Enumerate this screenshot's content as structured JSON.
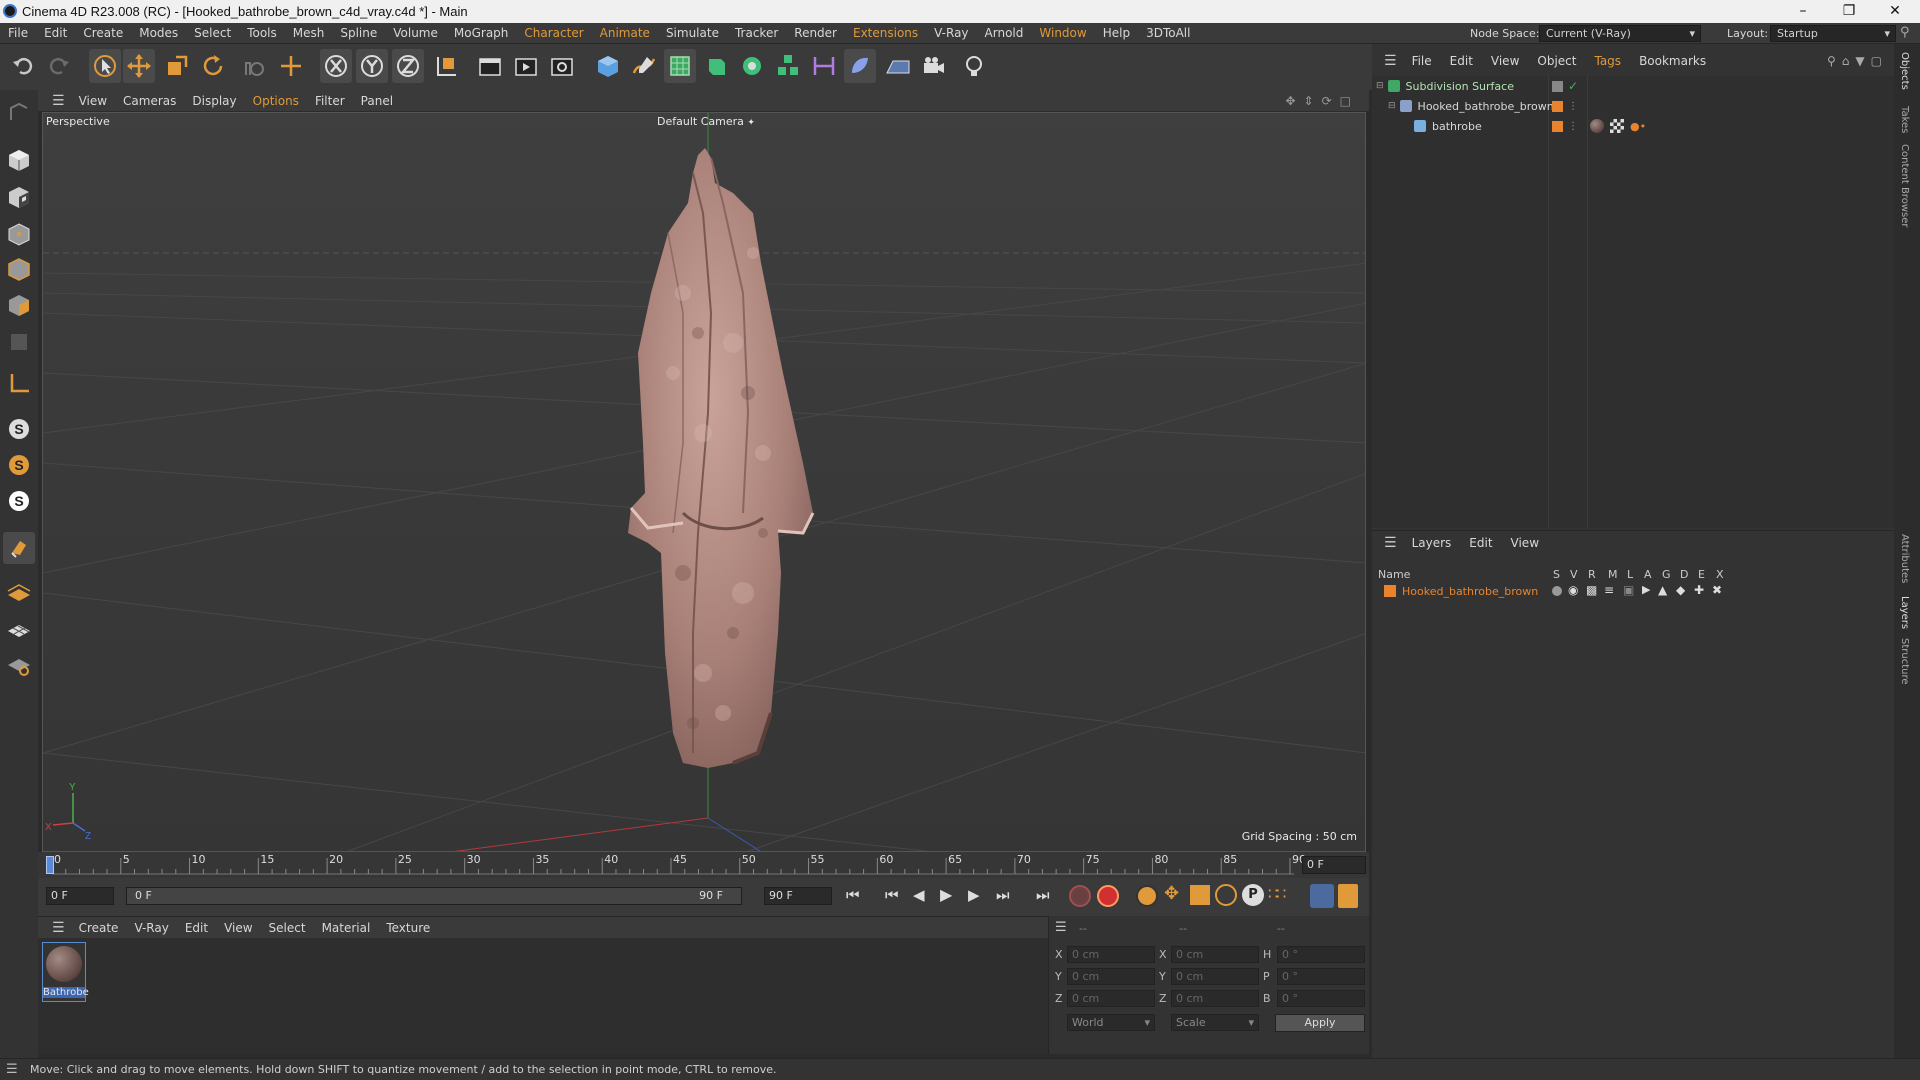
{
  "window": {
    "title": "Cinema 4D R23.008 (RC) - [Hooked_bathrobe_brown_c4d_vray.c4d *] - Main"
  },
  "menu": [
    "File",
    "Edit",
    "Create",
    "Modes",
    "Select",
    "Tools",
    "Mesh",
    "Spline",
    "Volume",
    "MoGraph",
    "Character",
    "Animate",
    "Simulate",
    "Tracker",
    "Render",
    "Extensions",
    "V-Ray",
    "Arnold",
    "Window",
    "Help",
    "3DToAll"
  ],
  "node_space": {
    "label": "Node Space:",
    "value": "Current (V-Ray)"
  },
  "layout": {
    "label": "Layout:",
    "value": "Startup"
  },
  "viewport": {
    "menu": [
      "View",
      "Cameras",
      "Display",
      "Options",
      "Filter",
      "Panel"
    ],
    "name": "Perspective",
    "camera": "Default Camera",
    "grid_spacing": "Grid Spacing : 50 cm"
  },
  "timeline": {
    "ticks": [
      "0",
      "5",
      "10",
      "15",
      "20",
      "25",
      "30",
      "35",
      "40",
      "45",
      "50",
      "55",
      "60",
      "65",
      "70",
      "75",
      "80",
      "85",
      "90"
    ],
    "current_frame": "0 F",
    "start_field": "0 F",
    "range_start": "0 F",
    "range_end": "90 F",
    "end_field": "90 F"
  },
  "material_panel": {
    "menu": [
      "Create",
      "V-Ray",
      "Edit",
      "View",
      "Select",
      "Material",
      "Texture"
    ],
    "materials": [
      {
        "name": "Bathrobe"
      }
    ]
  },
  "coords": {
    "header": [
      "--",
      "--",
      "--"
    ],
    "rows": [
      {
        "l1": "X",
        "v1": "0 cm",
        "l2": "X",
        "v2": "0 cm",
        "l3": "H",
        "v3": "0 °"
      },
      {
        "l1": "Y",
        "v1": "0 cm",
        "l2": "Y",
        "v2": "0 cm",
        "l3": "P",
        "v3": "0 °"
      },
      {
        "l1": "Z",
        "v1": "0 cm",
        "l2": "Z",
        "v2": "0 cm",
        "l3": "B",
        "v3": "0 °"
      }
    ],
    "mode1": "World",
    "mode2": "Scale",
    "apply": "Apply"
  },
  "object_manager": {
    "menu": [
      "File",
      "Edit",
      "View",
      "Object",
      "Tags",
      "Bookmarks"
    ],
    "objects": [
      {
        "name": "Subdivision Surface",
        "color": "#b5e3b2"
      },
      {
        "name": "Hooked_bathrobe_brown",
        "color": "#d8d8d8"
      },
      {
        "name": "bathrobe",
        "color": "#d8d8d8"
      }
    ]
  },
  "layer_manager": {
    "menu": [
      "Layers",
      "Edit",
      "View"
    ],
    "columns": [
      "Name",
      "S",
      "V",
      "R",
      "M",
      "L",
      "A",
      "G",
      "D",
      "E",
      "X"
    ],
    "layers": [
      {
        "name": "Hooked_bathrobe_brown",
        "color": "#e8842e"
      }
    ]
  },
  "side_tabs": [
    "Objects",
    "Takes",
    "Content Browser",
    "Attributes",
    "Layers",
    "Structure"
  ],
  "status": "Move: Click and drag to move elements. Hold down SHIFT to quantize movement / add to the selection in point mode, CTRL to remove.",
  "colors": {
    "accent": "#e09a3a",
    "layer": "#e8842e",
    "robe": "#b89088"
  }
}
